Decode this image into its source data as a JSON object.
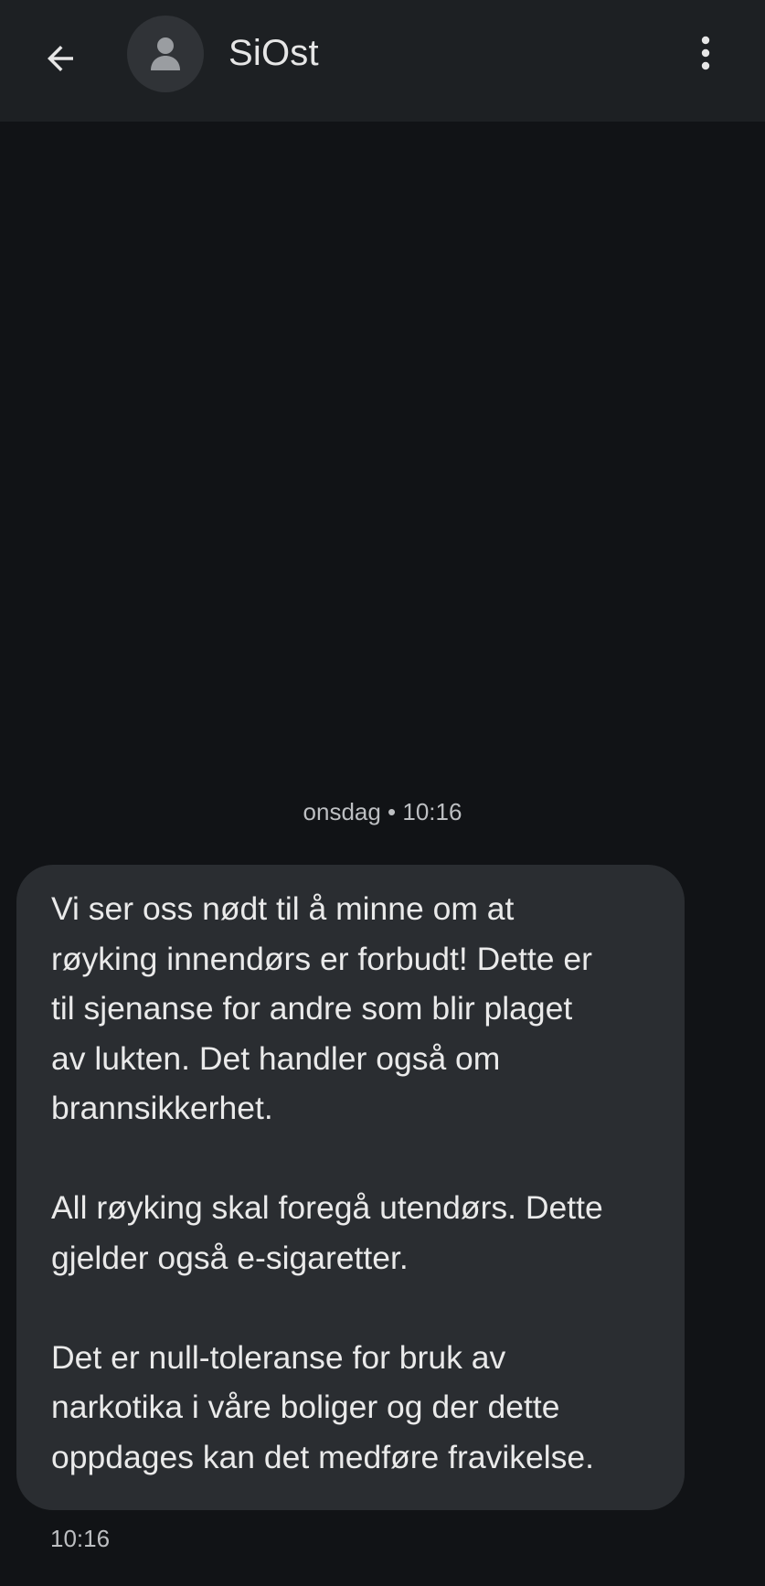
{
  "header": {
    "back_icon": "arrow-back-icon",
    "avatar_icon": "person-icon",
    "contact_name": "SiOst",
    "more_icon": "more-vert-icon"
  },
  "thread": {
    "date_divider": "onsdag • 10:16",
    "message": {
      "paragraphs": [
        "Vi ser oss nødt til å minne om at\nrøyking innendørs er forbudt! Dette er\ntil sjenanse for andre som blir plaget\nav lukten. Det handler også om\nbrannsikkerhet.",
        "All røyking skal foregå utendørs. Dette\ngjelder også e-sigaretter.",
        "Det er null-toleranse for bruk av\nnarkotika i våre boliger og der dette\noppdages kan det medføre fravikelse."
      ],
      "time": "10:16"
    }
  },
  "colors": {
    "background": "#111316",
    "header": "#1d2023",
    "bubble": "#2a2d31",
    "text": "#eaeaea",
    "secondary_text": "#bdbfc2"
  }
}
